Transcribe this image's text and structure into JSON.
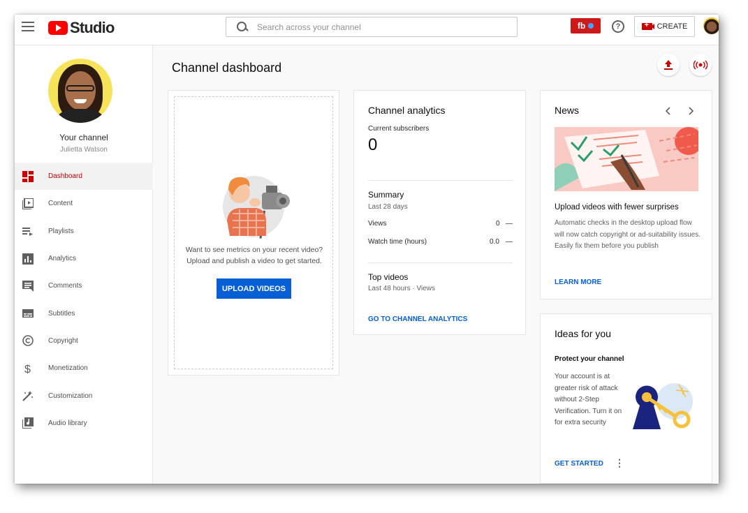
{
  "topbar": {
    "logo_text": "Studio",
    "search_placeholder": "Search across your channel",
    "fb_label": "fb",
    "help_label": "?",
    "create_label": "CREATE"
  },
  "sidebar": {
    "your_channel": "Your channel",
    "channel_name": "Julietta Watson",
    "items": [
      {
        "label": "Dashboard",
        "icon": "dashboard-icon",
        "active": true
      },
      {
        "label": "Content",
        "icon": "content-icon"
      },
      {
        "label": "Playlists",
        "icon": "playlists-icon"
      },
      {
        "label": "Analytics",
        "icon": "analytics-icon"
      },
      {
        "label": "Comments",
        "icon": "comments-icon"
      },
      {
        "label": "Subtitles",
        "icon": "subtitles-icon"
      },
      {
        "label": "Copyright",
        "icon": "copyright-icon"
      },
      {
        "label": "Monetization",
        "icon": "monetization-icon"
      },
      {
        "label": "Customization",
        "icon": "customization-icon"
      },
      {
        "label": "Audio library",
        "icon": "audio-library-icon"
      }
    ]
  },
  "main": {
    "title": "Channel dashboard",
    "upload_card": {
      "message_line1": "Want to see metrics on your recent video?",
      "message_line2": "Upload and publish a video to get started.",
      "button": "UPLOAD VIDEOS"
    },
    "analytics": {
      "title": "Channel analytics",
      "subscribers_label": "Current subscribers",
      "subscribers_value": "0",
      "summary_title": "Summary",
      "summary_period": "Last 28 days",
      "rows": [
        {
          "label": "Views",
          "value": "0",
          "trend": "—"
        },
        {
          "label": "Watch time (hours)",
          "value": "0.0",
          "trend": "—"
        }
      ],
      "top_videos_title": "Top videos",
      "top_videos_period": "Last 48 hours · Views",
      "link": "GO TO CHANNEL ANALYTICS"
    },
    "news": {
      "title": "News",
      "headline": "Upload videos with fewer surprises",
      "body": "Automatic checks in the desktop upload flow will now catch copyright or ad-suitability issues. Easily fix them before you publish",
      "link": "LEARN MORE"
    },
    "ideas": {
      "title": "Ideas for you",
      "subtitle": "Protect your channel",
      "body": "Your account is at greater risk of attack without 2-Step Verification. Turn it on for extra security",
      "link": "GET STARTED",
      "more": "⋮"
    }
  },
  "colors": {
    "accent_red": "#cc0000",
    "link_blue": "#065fd4"
  }
}
